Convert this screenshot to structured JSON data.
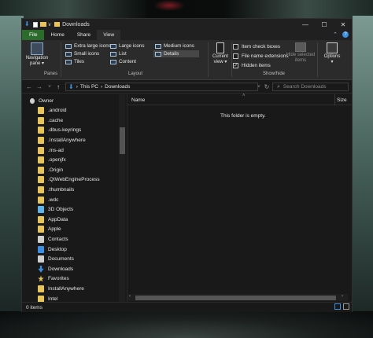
{
  "window": {
    "title": "Downloads",
    "controls": {
      "minimize": "—",
      "maximize": "☐",
      "close": "✕"
    }
  },
  "tabs": [
    {
      "label": "File",
      "kind": "file"
    },
    {
      "label": "Home",
      "kind": "normal"
    },
    {
      "label": "Share",
      "kind": "normal"
    },
    {
      "label": "View",
      "kind": "active"
    }
  ],
  "tabbar_right": {
    "collapse": "⌃",
    "help": "?"
  },
  "ribbon": {
    "navigation_pane": {
      "line1": "Navigation",
      "line2": "pane ▾"
    },
    "panes_label": "Panes",
    "layout": {
      "col1": [
        "Extra large icons",
        "Small icons",
        "Tiles"
      ],
      "col2": [
        "Large icons",
        "List",
        "Content"
      ],
      "col3": [
        "Medium icons",
        "Details"
      ],
      "selected": "Details",
      "label": "Layout"
    },
    "current_view": {
      "line1": "Current",
      "line2": "view ▾"
    },
    "show_hide": {
      "item_check_boxes": {
        "label": "Item check boxes",
        "checked": false
      },
      "file_name_extensions": {
        "label": "File name extensions",
        "checked": false
      },
      "hidden_items": {
        "label": "Hidden items",
        "checked": true
      },
      "hide_selected": {
        "line1": "Hide selected",
        "line2": "items"
      },
      "label": "Show/hide"
    },
    "options": {
      "line1": "Options",
      "line2": "▾"
    }
  },
  "address": {
    "back": "←",
    "forward": "→",
    "recent": "˅",
    "up": "↑",
    "path": [
      "This PC",
      "Downloads"
    ],
    "separator": "›",
    "dropdown": "˅",
    "refresh": "↻",
    "search_placeholder": "Search Downloads"
  },
  "nav_items": [
    {
      "label": "Owner",
      "icon": "user-icon",
      "indent": 0
    },
    {
      "label": ".android",
      "icon": "folder-icon",
      "indent": 1
    },
    {
      "label": ".cache",
      "icon": "folder-icon",
      "indent": 1
    },
    {
      "label": ".dbus-keyrings",
      "icon": "folder-icon",
      "indent": 1
    },
    {
      "label": ".InstallAnywhere",
      "icon": "folder-icon",
      "indent": 1
    },
    {
      "label": ".ms-ad",
      "icon": "folder-icon",
      "indent": 1
    },
    {
      "label": ".openjfx",
      "icon": "folder-icon",
      "indent": 1
    },
    {
      "label": ".Origin",
      "icon": "folder-icon",
      "indent": 1
    },
    {
      "label": ".QtWebEngineProcess",
      "icon": "folder-icon",
      "indent": 1
    },
    {
      "label": ".thumbnails",
      "icon": "folder-icon",
      "indent": 1
    },
    {
      "label": ".wdc",
      "icon": "folder-icon",
      "indent": 1
    },
    {
      "label": "3D Objects",
      "icon": "3d-objects-icon",
      "indent": 1
    },
    {
      "label": "AppData",
      "icon": "folder-icon",
      "indent": 1
    },
    {
      "label": "Apple",
      "icon": "apple-folder-icon",
      "indent": 1
    },
    {
      "label": "Contacts",
      "icon": "contacts-icon",
      "indent": 1
    },
    {
      "label": "Desktop",
      "icon": "desktop-icon",
      "indent": 1
    },
    {
      "label": "Documents",
      "icon": "documents-icon",
      "indent": 1
    },
    {
      "label": "Downloads",
      "icon": "downloads-icon",
      "indent": 1
    },
    {
      "label": "Favorites",
      "icon": "star-icon",
      "indent": 1
    },
    {
      "label": "InstallAnywhere",
      "icon": "folder-icon",
      "indent": 1
    },
    {
      "label": "Intel",
      "icon": "folder-icon",
      "indent": 1
    }
  ],
  "columns": {
    "name": "Name",
    "size": "Size",
    "sort_indicator": "˄"
  },
  "empty_message": "This folder is empty.",
  "status": {
    "count": "0 items"
  },
  "colors": {
    "file_tab": "#2b6b2b",
    "folder": "#e7c45c",
    "accent_blue": "#3b8ee0"
  }
}
